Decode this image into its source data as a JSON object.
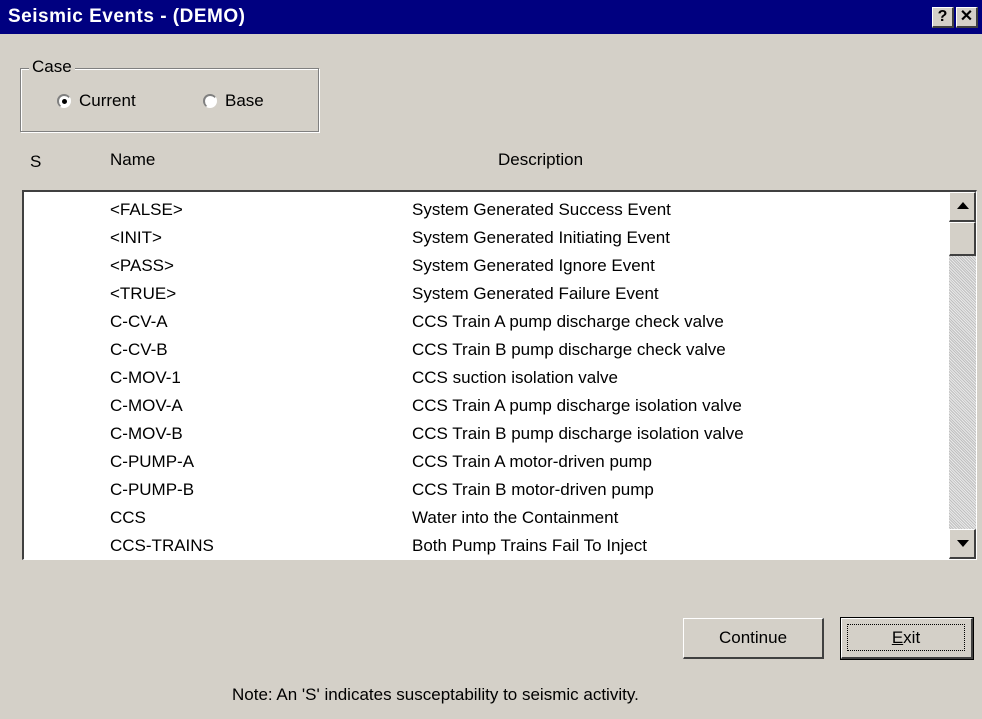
{
  "window": {
    "title": "Seismic Events  -  (DEMO)",
    "help_label": "?",
    "close_label": "✕"
  },
  "case": {
    "legend": "Case",
    "options": [
      {
        "label": "Current",
        "selected": true
      },
      {
        "label": "Base",
        "selected": false
      }
    ]
  },
  "columns": {
    "s": "S",
    "name": "Name",
    "description": "Description"
  },
  "rows": [
    {
      "s": "",
      "name": "<FALSE>",
      "description": "System Generated Success Event"
    },
    {
      "s": "",
      "name": "<INIT>",
      "description": "System Generated Initiating Event"
    },
    {
      "s": "",
      "name": "<PASS>",
      "description": "System Generated Ignore Event"
    },
    {
      "s": "",
      "name": "<TRUE>",
      "description": "System Generated Failure Event"
    },
    {
      "s": "",
      "name": "C-CV-A",
      "description": "CCS Train A pump discharge check valve"
    },
    {
      "s": "",
      "name": "C-CV-B",
      "description": "CCS Train B pump discharge check valve"
    },
    {
      "s": "",
      "name": "C-MOV-1",
      "description": "CCS suction isolation valve"
    },
    {
      "s": "",
      "name": "C-MOV-A",
      "description": "CCS Train A pump discharge isolation valve"
    },
    {
      "s": "",
      "name": "C-MOV-B",
      "description": "CCS Train B pump discharge isolation valve"
    },
    {
      "s": "",
      "name": "C-PUMP-A",
      "description": "CCS Train A motor-driven pump"
    },
    {
      "s": "",
      "name": "C-PUMP-B",
      "description": "CCS Train B motor-driven pump"
    },
    {
      "s": "",
      "name": "CCS",
      "description": "Water into the Containment"
    },
    {
      "s": "",
      "name": "CCS-TRAINS",
      "description": "Both Pump Trains Fail To Inject"
    }
  ],
  "buttons": {
    "continue": "Continue",
    "exit_first": "E",
    "exit_rest": "xit"
  },
  "note": "Note: An 'S' indicates susceptability to seismic activity."
}
